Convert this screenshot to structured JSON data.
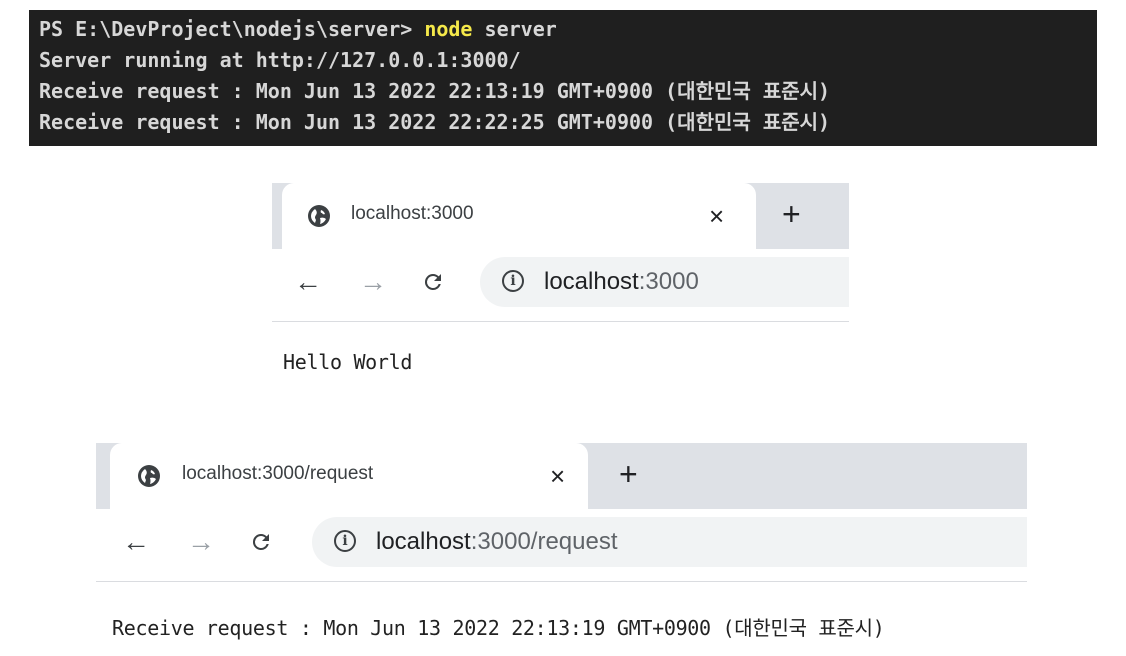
{
  "terminal": {
    "prompt": "PS E:\\DevProject\\nodejs\\server> ",
    "command": "node",
    "args": " server",
    "lines": [
      "Server running at http://127.0.0.1:3000/",
      "Receive request : Mon Jun 13 2022 22:13:19 GMT+0900 (대한민국 표준시)",
      "Receive request : Mon Jun 13 2022 22:22:25 GMT+0900 (대한민국 표준시)"
    ]
  },
  "browser1": {
    "tab_title": "localhost:3000",
    "close_label": "×",
    "new_tab_label": "+",
    "back_label": "←",
    "forward_label": "→",
    "reload_label": "C",
    "info_label": "i",
    "url_host": "localhost",
    "url_rest": ":3000",
    "body_text": "Hello World"
  },
  "browser2": {
    "tab_title": "localhost:3000/request",
    "close_label": "×",
    "new_tab_label": "+",
    "back_label": "←",
    "forward_label": "→",
    "reload_label": "C",
    "info_label": "i",
    "url_host": "localhost",
    "url_rest": ":3000/request",
    "body_text": "Receive request : Mon Jun 13 2022 22:13:19 GMT+0900 (대한민국 표준시)"
  },
  "colors": {
    "terminal_bg": "#1f1f1f",
    "terminal_text": "#d7d7d7",
    "terminal_command": "#f5e94a",
    "tabstrip": "#dee1e6",
    "omnibox": "#f1f3f4"
  },
  "icons": {
    "tab_favicon": "globe-icon",
    "close": "close-icon",
    "new_tab": "plus-icon",
    "back": "arrow-left-icon",
    "forward": "arrow-right-icon",
    "reload": "reload-icon",
    "site_info": "info-icon"
  }
}
